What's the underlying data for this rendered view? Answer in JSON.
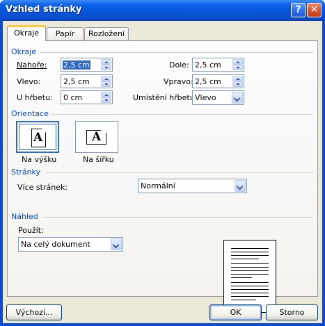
{
  "window": {
    "title": "Vzhled stránky",
    "help_glyph": "?",
    "close_glyph": "✕"
  },
  "tabs": [
    {
      "label": "Okraje",
      "active": true
    },
    {
      "label": "Papír"
    },
    {
      "label": "Rozložení"
    }
  ],
  "margins": {
    "group_label": "Okraje",
    "top": {
      "label": "Nahoře:",
      "value": "2,5 cm"
    },
    "bottom": {
      "label": "Dole:",
      "value": "2,5 cm"
    },
    "left": {
      "label": "Vlevo:",
      "value": "2,5 cm"
    },
    "right": {
      "label": "Vpravo:",
      "value": "2,5 cm"
    },
    "gutter": {
      "label": "U hřbetu:",
      "value": "0 cm"
    },
    "gutter_position": {
      "label": "Umístění hřbetu:",
      "value": "Vlevo"
    }
  },
  "orientation": {
    "group_label": "Orientace",
    "portrait": {
      "label": "Na výšku",
      "glyph": "A",
      "selected": true
    },
    "landscape": {
      "label": "Na šířku",
      "glyph": "A"
    }
  },
  "pages": {
    "group_label": "Stránky",
    "multiple_label": "Více stránek:",
    "multiple_value": "Normální"
  },
  "preview": {
    "group_label": "Náhled",
    "apply_label": "Použít:",
    "apply_value": "Na celý dokument"
  },
  "buttons": {
    "default": "Výchozí...",
    "ok": "OK",
    "cancel": "Storno"
  },
  "colors": {
    "titlebar": "#0a5fe8",
    "group_label": "#0046d5",
    "selection": "#316ac5",
    "active_tab_accent": "#ffc83c"
  }
}
